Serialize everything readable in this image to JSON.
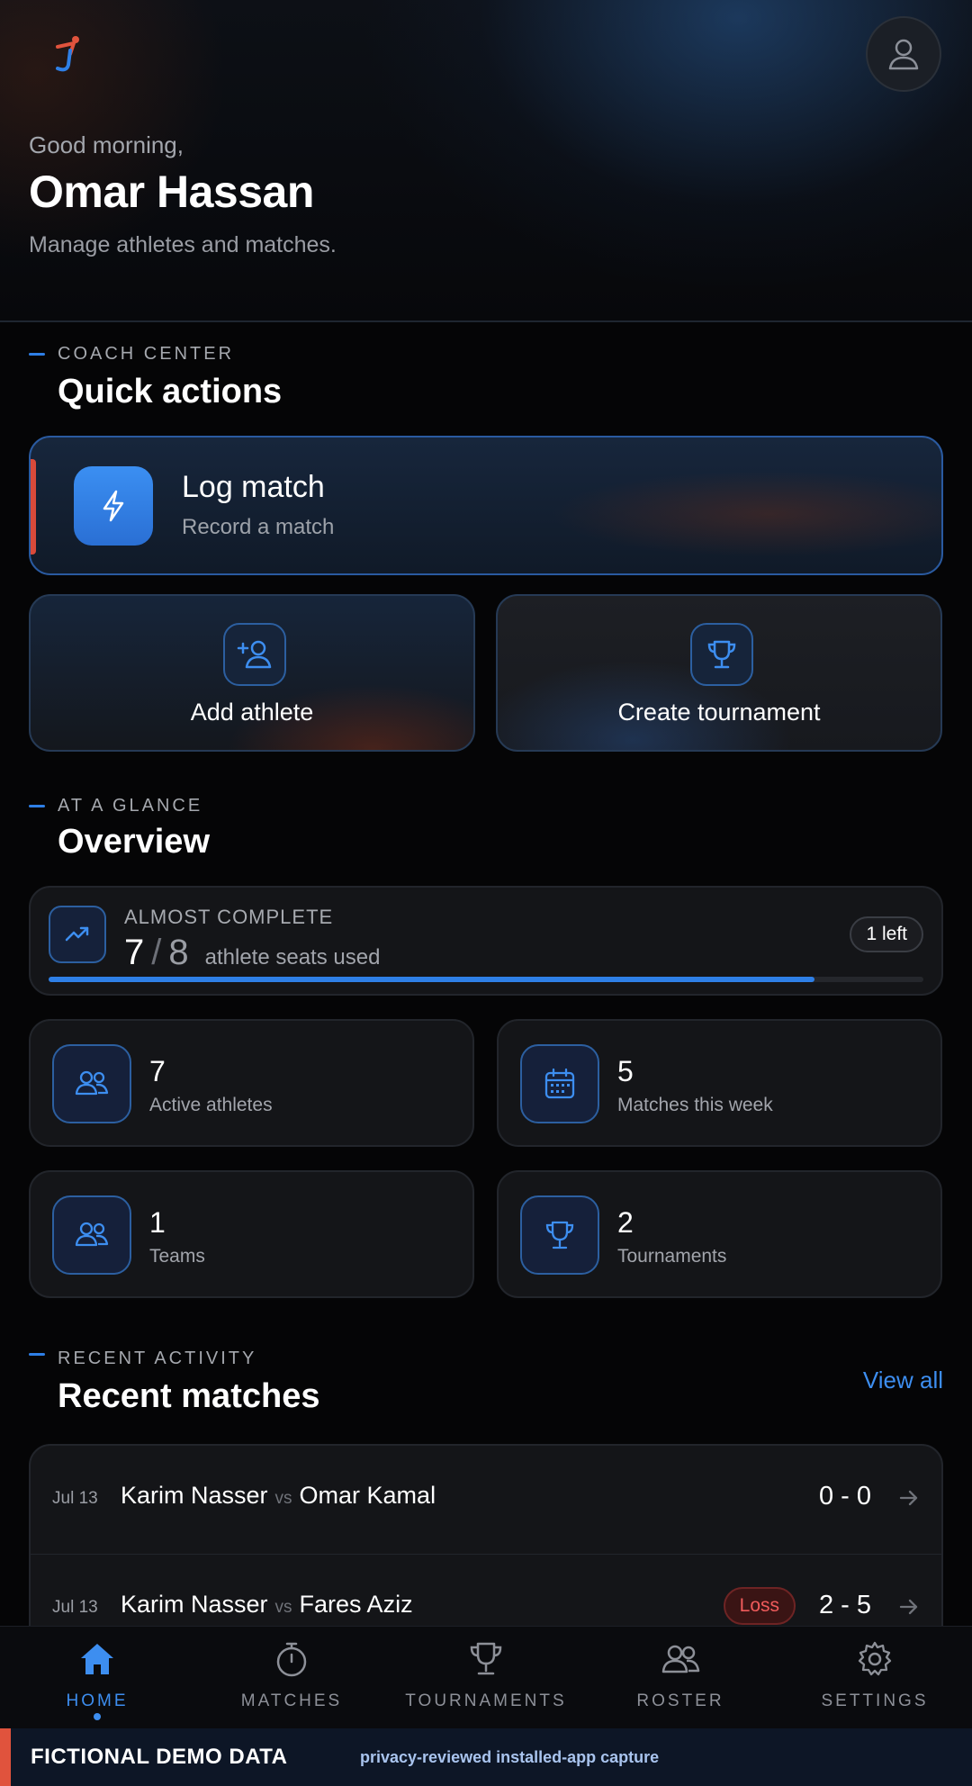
{
  "header": {
    "greeting": "Good morning,",
    "user_name": "Omar Hassan",
    "tagline": "Manage athletes and matches."
  },
  "quick_actions": {
    "kicker": "COACH CENTER",
    "title": "Quick actions",
    "log_match": {
      "title": "Log match",
      "subtitle": "Record a match",
      "icon": "lightning-icon"
    },
    "add_athlete": {
      "label": "Add athlete",
      "icon": "add-user-icon"
    },
    "create_tournament": {
      "label": "Create tournament",
      "icon": "trophy-icon"
    }
  },
  "overview": {
    "kicker": "AT A GLANCE",
    "title": "Overview",
    "seats": {
      "status": "ALMOST COMPLETE",
      "used": "7",
      "slash": "/",
      "total": "8",
      "label": "athlete seats used",
      "badge": "1 left",
      "progress_fraction": 0.875
    },
    "stats": [
      {
        "value": "7",
        "label": "Active athletes",
        "icon": "users-icon"
      },
      {
        "value": "5",
        "label": "Matches this week",
        "icon": "calendar-icon"
      },
      {
        "value": "1",
        "label": "Teams",
        "icon": "users-icon"
      },
      {
        "value": "2",
        "label": "Tournaments",
        "icon": "trophy-icon"
      }
    ]
  },
  "recent": {
    "kicker": "RECENT ACTIVITY",
    "title": "Recent matches",
    "view_all": "View all",
    "matches": [
      {
        "date": "Jul 13",
        "player1": "Karim Nasser",
        "vs": "vs",
        "player2": "Omar Kamal",
        "score": "0 - 0",
        "result": ""
      },
      {
        "date": "Jul 13",
        "player1": "Karim Nasser",
        "vs": "vs",
        "player2": "Fares Aziz",
        "score": "2 - 5",
        "result": "Loss"
      }
    ]
  },
  "nav": {
    "items": [
      {
        "label": "HOME",
        "icon": "home-icon",
        "active": true
      },
      {
        "label": "MATCHES",
        "icon": "stopwatch-icon",
        "active": false
      },
      {
        "label": "TOURNAMENTS",
        "icon": "trophy-icon",
        "active": false
      },
      {
        "label": "ROSTER",
        "icon": "users-icon",
        "active": false
      },
      {
        "label": "SETTINGS",
        "icon": "gear-icon",
        "active": false
      }
    ]
  },
  "banner": {
    "title": "FICTIONAL DEMO DATA",
    "note": "privacy-reviewed installed-app capture"
  },
  "colors": {
    "accent": "#2e7fe6",
    "loss": "#ef5b5b",
    "background": "#050506"
  }
}
